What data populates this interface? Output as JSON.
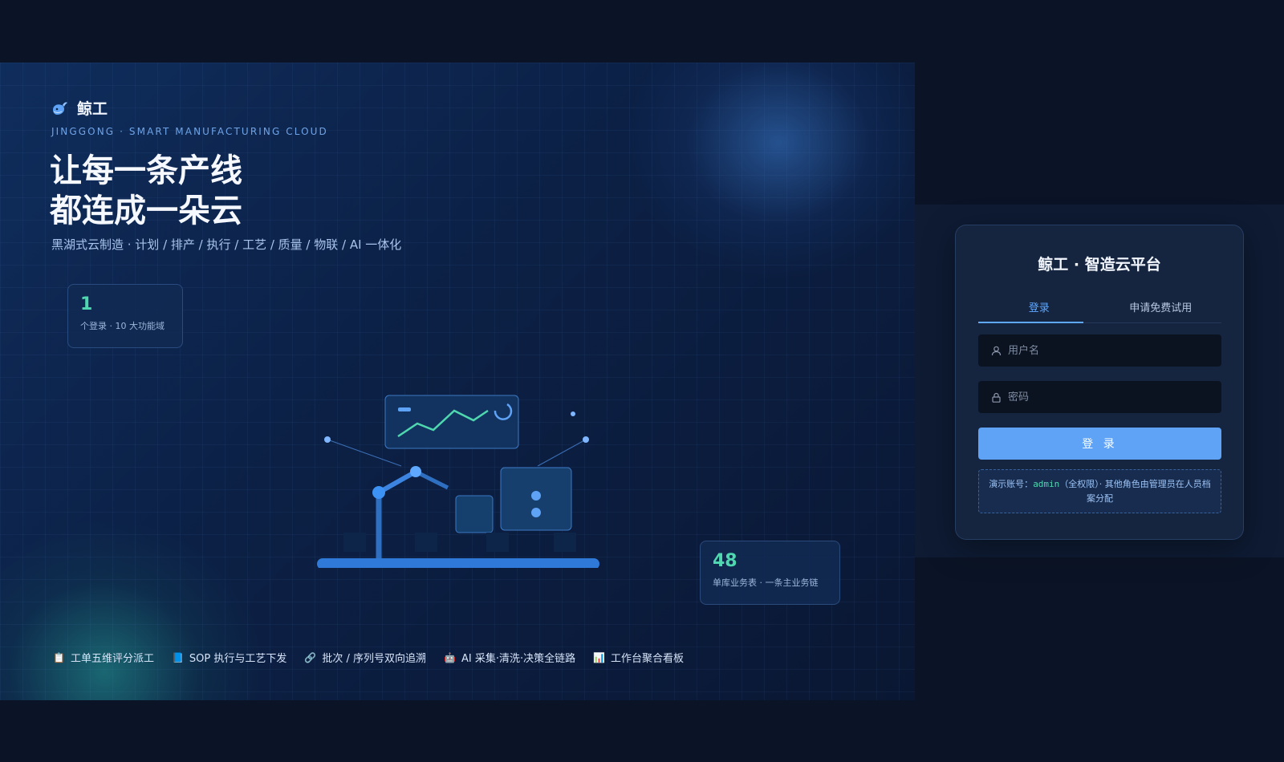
{
  "brand": {
    "name": "鲸工",
    "subtitle": "JINGGONG · SMART MANUFACTURING CLOUD"
  },
  "hero": {
    "headline_line1": "让每一条产线",
    "headline_line2": "都连成一朵云",
    "tagline": "黑湖式云制造 · 计划 / 排产 / 执行 / 工艺 / 质量 / 物联 / AI 一体化"
  },
  "stats": [
    {
      "value": "1",
      "label": "个登录 · 10 大功能域"
    },
    {
      "value": "48",
      "label": "单库业务表 · 一条主业务链"
    }
  ],
  "features": [
    {
      "icon": "📋",
      "label": "工单五维评分派工"
    },
    {
      "icon": "📘",
      "label": "SOP 执行与工艺下发"
    },
    {
      "icon": "🔗",
      "label": "批次 / 序列号双向追溯"
    },
    {
      "icon": "🤖",
      "label": "AI 采集·清洗·决策全链路"
    },
    {
      "icon": "📊",
      "label": "工作台聚合看板"
    }
  ],
  "login": {
    "title": "鲸工 · 智造云平台",
    "tabs": [
      {
        "label": "登录",
        "active": true
      },
      {
        "label": "申请免费试用",
        "active": false
      }
    ],
    "username_placeholder": "用户名",
    "password_placeholder": "密码",
    "submit_label": "登 录",
    "demo_prefix": "演示账号：",
    "demo_account": "admin",
    "demo_suffix": "（全权限）· 其他角色由管理员在人员档案分配"
  },
  "colors": {
    "accent": "#5ea3f6",
    "teal": "#4fd8b0",
    "background": "#0b1426"
  }
}
